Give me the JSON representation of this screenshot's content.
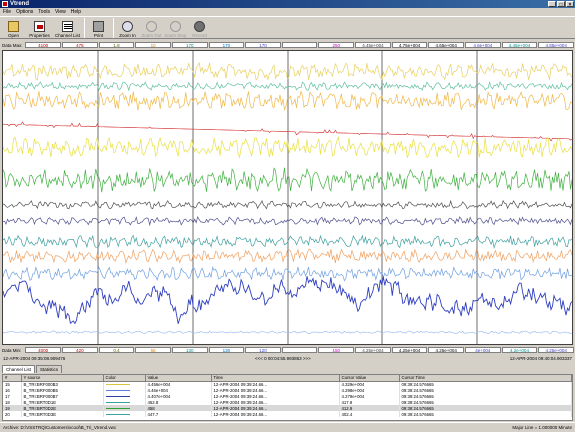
{
  "window": {
    "title": "Vtrend"
  },
  "menu": [
    "File",
    "Options",
    "Tools",
    "View",
    "Help"
  ],
  "toolbar": [
    {
      "label": "Open",
      "icon": "folder-icon",
      "enabled": true
    },
    {
      "label": "Properties",
      "icon": "properties-icon",
      "enabled": true
    },
    {
      "label": "Channel List",
      "icon": "channel-list-icon",
      "enabled": true
    },
    {
      "label": "Print",
      "icon": "print-icon",
      "enabled": true
    },
    {
      "label": "Zoom In",
      "icon": "zoom-in-icon",
      "enabled": true
    },
    {
      "label": "Zoom Out",
      "icon": "zoom-out-icon",
      "enabled": false
    },
    {
      "label": "Zoom Stop",
      "icon": "zoom-stop-icon",
      "enabled": false
    },
    {
      "label": "Record",
      "icon": "record-icon",
      "enabled": false
    }
  ],
  "data_max": {
    "label": "Data Max:",
    "values": [
      {
        "text": "4100",
        "color": "#b00000"
      },
      {
        "text": "475",
        "color": "#b00000"
      },
      {
        "text": "1.8",
        "color": "#606000"
      },
      {
        "text": "10",
        "color": "#d08000"
      },
      {
        "text": "170",
        "color": "#009090"
      },
      {
        "text": "170",
        "color": "#0070c0"
      },
      {
        "text": "170",
        "color": "#4040c0"
      },
      {
        "text": "",
        "color": "#000"
      },
      {
        "text": "250",
        "color": "#c000c0"
      },
      {
        "text": "4.45e+004",
        "color": "#404040"
      },
      {
        "text": "4.75e+004",
        "color": "#000"
      },
      {
        "text": "4.65e+004",
        "color": "#000"
      },
      {
        "text": "4.6e+004",
        "color": "#4040c0"
      },
      {
        "text": "4.45e+004",
        "color": "#009090"
      },
      {
        "text": "4.85e+004",
        "color": "#4040c0"
      }
    ]
  },
  "data_min": {
    "label": "Data Min:",
    "values": [
      {
        "text": "4000",
        "color": "#b00000"
      },
      {
        "text": "420",
        "color": "#b00000"
      },
      {
        "text": "0.4",
        "color": "#606000"
      },
      {
        "text": "55",
        "color": "#d08000"
      },
      {
        "text": "130",
        "color": "#009090"
      },
      {
        "text": "130",
        "color": "#0070c0"
      },
      {
        "text": "120",
        "color": "#4040c0"
      },
      {
        "text": "",
        "color": "#000"
      },
      {
        "text": "150",
        "color": "#c000c0"
      },
      {
        "text": "4.25e+004",
        "color": "#404040"
      },
      {
        "text": "4.25e+004",
        "color": "#000"
      },
      {
        "text": "4.25e+004",
        "color": "#000"
      },
      {
        "text": "4e+004",
        "color": "#4040c0"
      },
      {
        "text": "4.2e+004",
        "color": "#009090"
      },
      {
        "text": "4.25e+004",
        "color": "#4040c0"
      }
    ]
  },
  "time_axis": {
    "start": "12-APR-2004 09:35:08.909476",
    "center": "<<< 0 00:04:55.993863 >>>",
    "end": "12-APR-2004 09:40:04.903337"
  },
  "tabs": [
    {
      "label": "Channel List",
      "active": true
    },
    {
      "label": "Statistics",
      "active": false
    }
  ],
  "grid": {
    "columns": [
      "#",
      "Y source",
      "Color",
      "Value",
      "Time",
      "Cursor Value",
      "Cursor Time"
    ],
    "rows": [
      {
        "num": "15",
        "source": "B_TRI:BRF000B3",
        "color": "#d8c840",
        "value": "4.456e+004",
        "time": "12-APR-2004 09:39:24.66...",
        "cursor_value": "4.329e+004",
        "cursor_time": "09:39:24.576665",
        "selected": false
      },
      {
        "num": "16",
        "source": "B_TRI:BRF000B5",
        "color": "#6080e0",
        "value": "4.46e+004",
        "time": "12-APR-2004 09:39:24.66...",
        "cursor_value": "4.298e+004",
        "cursor_time": "09:39:24.576665",
        "selected": false
      },
      {
        "num": "17",
        "source": "B_TRI:BRF000B7",
        "color": "#3040a0",
        "value": "4.407e+004",
        "time": "12-APR-2004 09:39:24.66...",
        "cursor_value": "4.279e+004",
        "cursor_time": "09:39:24.576665",
        "selected": false
      },
      {
        "num": "18",
        "source": "B_TRI:BRT0D1E",
        "color": "#30a0a0",
        "value": "452.8",
        "time": "12-APR-2004 09:39:24.66...",
        "cursor_value": "417.9",
        "cursor_time": "09:39:24.576665",
        "selected": false
      },
      {
        "num": "19",
        "source": "B_TRI:BRT0D2E",
        "color": "#30a030",
        "value": "458",
        "time": "12-APR-2004 09:39:24.66...",
        "cursor_value": "412.9",
        "cursor_time": "09:39:24.576665",
        "selected": true
      },
      {
        "num": "20",
        "source": "B_TRI:BRT0D3E",
        "color": "#40a0a0",
        "value": "447.7",
        "time": "12-APR-2004 09:39:24.66...",
        "cursor_value": "402.4",
        "cursor_time": "09:39:24.576665",
        "selected": false
      }
    ]
  },
  "status": {
    "archive": "Archive:   D:\\VSSTRQ\\Customers\\vcool\\B_Tri_Vtrend.vwc",
    "major": "Major Line = 1.000000 Minute"
  },
  "plot": {
    "traces": [
      {
        "color": "#e8d060",
        "kind": "noise",
        "level": 0.07,
        "amp": 0.025
      },
      {
        "color": "#60c0a0",
        "kind": "noise",
        "level": 0.12,
        "amp": 0.012
      },
      {
        "color": "#f0b848",
        "kind": "noise",
        "level": 0.17,
        "amp": 0.028
      },
      {
        "color": "#d84040",
        "kind": "step",
        "level": 0.25,
        "amp": 0.01
      },
      {
        "color": "#e8e040",
        "kind": "noise",
        "level": 0.33,
        "amp": 0.03
      },
      {
        "color": "#40b040",
        "kind": "noise",
        "level": 0.44,
        "amp": 0.035
      },
      {
        "color": "#505050",
        "kind": "noise",
        "level": 0.525,
        "amp": 0.012
      },
      {
        "color": "#505090",
        "kind": "noise",
        "level": 0.58,
        "amp": 0.012
      },
      {
        "color": "#40a0a0",
        "kind": "noise",
        "level": 0.65,
        "amp": 0.018
      },
      {
        "color": "#f0a060",
        "kind": "noise",
        "level": 0.7,
        "amp": 0.02
      },
      {
        "color": "#70a0e0",
        "kind": "noise",
        "level": 0.76,
        "amp": 0.02
      },
      {
        "color": "#3040c0",
        "kind": "walk",
        "level": 0.85,
        "amp": 0.06
      },
      {
        "color": "#a0c0f0",
        "kind": "noise",
        "level": 0.96,
        "amp": 0.004
      }
    ],
    "major_lines": 5
  }
}
